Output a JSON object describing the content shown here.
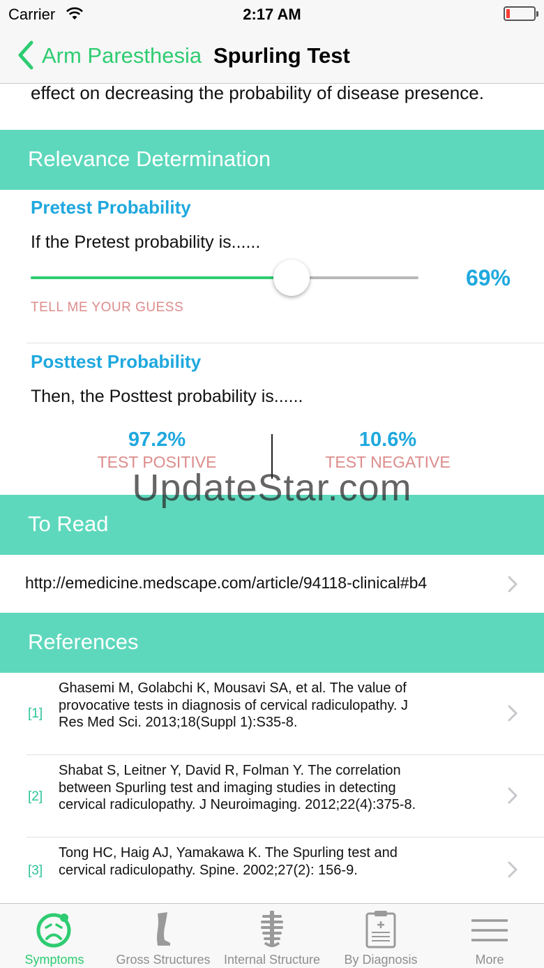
{
  "status_bar": {
    "carrier": "Carrier",
    "time": "2:17 AM",
    "battery_level": 0.12
  },
  "nav": {
    "back_label": "Arm Paresthesia",
    "title": "Spurling Test"
  },
  "intro": {
    "text": "effect on decreasing the probability of disease presence."
  },
  "relevance": {
    "header": "Relevance Determination",
    "pretest_title": "Pretest Probability",
    "pretest_prompt": "If the Pretest probability is......",
    "slider_value": 0.69,
    "slider_value_label": "69%",
    "guess_label": "TELL ME YOUR GUESS",
    "posttest_title": "Posttest Probability",
    "posttest_prompt": "Then, the Posttest probability is......",
    "positive_value": "97.2%",
    "positive_label": "TEST POSITIVE",
    "negative_value": "10.6%",
    "negative_label": "TEST NEGATIVE"
  },
  "watermark": "UpdateStar.com",
  "to_read": {
    "header": "To Read",
    "link": "http://emedicine.medscape.com/article/94118-clinical#b4"
  },
  "references": {
    "header": "References",
    "items": [
      {
        "num": "[1]",
        "text": "Ghasemi M, Golabchi K, Mousavi SA, et al. The value of provocative tests in diagnosis of cervical radiculopathy. J Res Med Sci. 2013;18(Suppl 1):S35-8."
      },
      {
        "num": "[2]",
        "text": "Shabat S, Leitner Y, David R, Folman Y. The correlation between Spurling test and imaging studies in detecting cervical radiculopathy. J Neuroimaging. 2012;22(4):375-8."
      },
      {
        "num": "[3]",
        "text": "Tong HC, Haig AJ, Yamakawa K. The Spurling test and cervical radiculopathy. Spine. 2002;27(2): 156-9."
      }
    ]
  },
  "tabs": [
    {
      "label": "Symptoms",
      "icon": "symptoms-face-icon",
      "active": true
    },
    {
      "label": "Gross Structures",
      "icon": "leg-icon",
      "active": false
    },
    {
      "label": "Internal Structure",
      "icon": "spine-icon",
      "active": false
    },
    {
      "label": "By Diagnosis",
      "icon": "clipboard-icon",
      "active": false
    },
    {
      "label": "More",
      "icon": "menu-icon",
      "active": false
    }
  ],
  "colors": {
    "accent": "#2ecc71",
    "section": "#5ed8bc",
    "value_blue": "#1fa8de",
    "label_pink": "#dd8b8b"
  }
}
